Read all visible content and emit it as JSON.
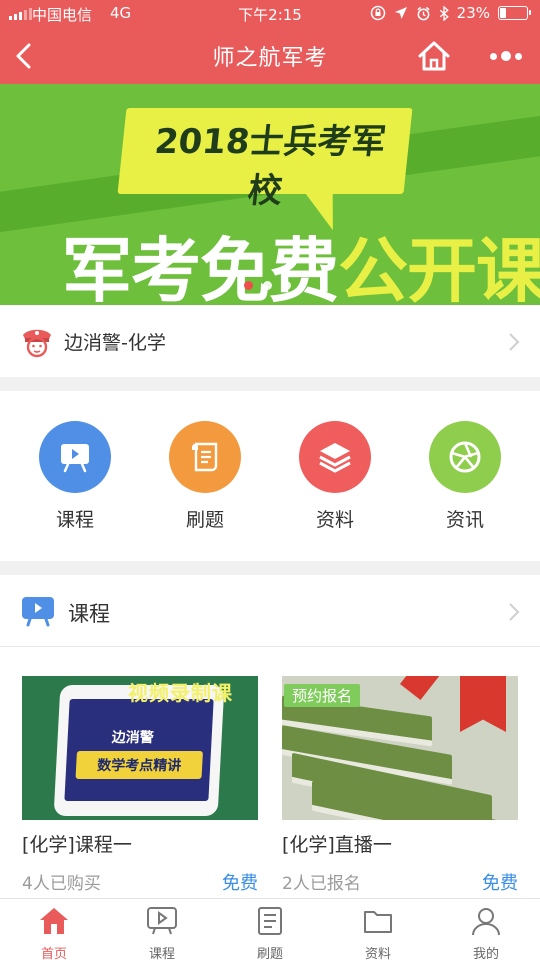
{
  "status_bar": {
    "carrier": "中国电信",
    "network": "4G",
    "time": "下午2:15",
    "battery_pct": "23%",
    "battery_level": 0.23
  },
  "nav": {
    "title": "师之航军考",
    "back_icon": "chevron-left-icon",
    "home_icon": "home-icon",
    "more_icon": "more-dots-icon"
  },
  "banner": {
    "headline": "2018士兵考军校",
    "main_white": "军考免费",
    "main_yellow": "公开课",
    "active_slide": 1,
    "slide_count": 3
  },
  "subject": {
    "name": "边消警-化学"
  },
  "grid": {
    "items": [
      {
        "label": "课程",
        "icon": "video-board-icon",
        "color": "#4f8fe6"
      },
      {
        "label": "刷题",
        "icon": "scroll-icon",
        "color": "#f29a3d"
      },
      {
        "label": "资料",
        "icon": "layers-icon",
        "color": "#ef5d5d"
      },
      {
        "label": "资讯",
        "icon": "aperture-icon",
        "color": "#8fcd4c"
      }
    ]
  },
  "courses": {
    "title": "课程",
    "cards": [
      {
        "title": "[化学]课程一",
        "meta": "4人已购买",
        "price": "免费",
        "thumb_head": "视频录制课",
        "thumb_line1": "边消警",
        "thumb_line2": "数学考点精讲"
      },
      {
        "title": "[化学]直播一",
        "meta": "2人已报名",
        "price": "免费",
        "tag": "预约报名"
      }
    ]
  },
  "tabbar": {
    "items": [
      {
        "label": "首页",
        "icon": "home-icon",
        "active": true
      },
      {
        "label": "课程",
        "icon": "play-board-icon",
        "active": false
      },
      {
        "label": "刷题",
        "icon": "exercise-icon",
        "active": false
      },
      {
        "label": "资料",
        "icon": "folder-icon",
        "active": false
      },
      {
        "label": "我的",
        "icon": "user-icon",
        "active": false
      }
    ]
  },
  "colors": {
    "brand": "#e95b5b",
    "price": "#3a8ee6",
    "banner_green": "#6dbf3c",
    "banner_yellow": "#e8f046"
  }
}
